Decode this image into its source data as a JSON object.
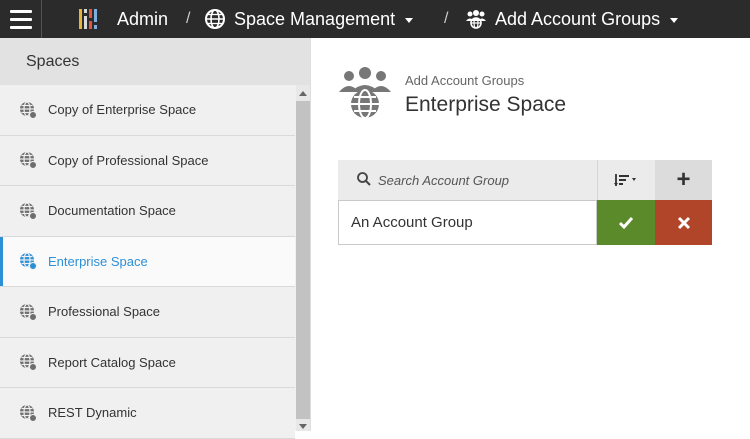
{
  "header": {
    "breadcrumbs": [
      {
        "label": "Admin",
        "icon": "report-grid-icon"
      },
      {
        "label": "Space Management",
        "icon": "globe-icon"
      },
      {
        "label": "Add Account Groups",
        "icon": "account-group-icon"
      }
    ],
    "separator": "/"
  },
  "sidebar": {
    "title": "Spaces",
    "items": [
      {
        "label": "Copy of Enterprise Space",
        "active": false
      },
      {
        "label": "Copy of Professional Space",
        "active": false
      },
      {
        "label": "Documentation Space",
        "active": false
      },
      {
        "label": "Enterprise Space",
        "active": true
      },
      {
        "label": "Professional Space",
        "active": false
      },
      {
        "label": "Report Catalog Space",
        "active": false
      },
      {
        "label": "REST Dynamic",
        "active": false
      }
    ]
  },
  "main": {
    "subtitle": "Add Account Groups",
    "title": "Enterprise Space",
    "search": {
      "placeholder": "Search Account Group"
    },
    "add_label": "+",
    "new_group": {
      "value": "An Account Group"
    }
  },
  "colors": {
    "topbar": "#2b2b2b",
    "active": "#2d8fd5",
    "confirm": "#5a8a2a",
    "cancel": "#b0452a"
  }
}
